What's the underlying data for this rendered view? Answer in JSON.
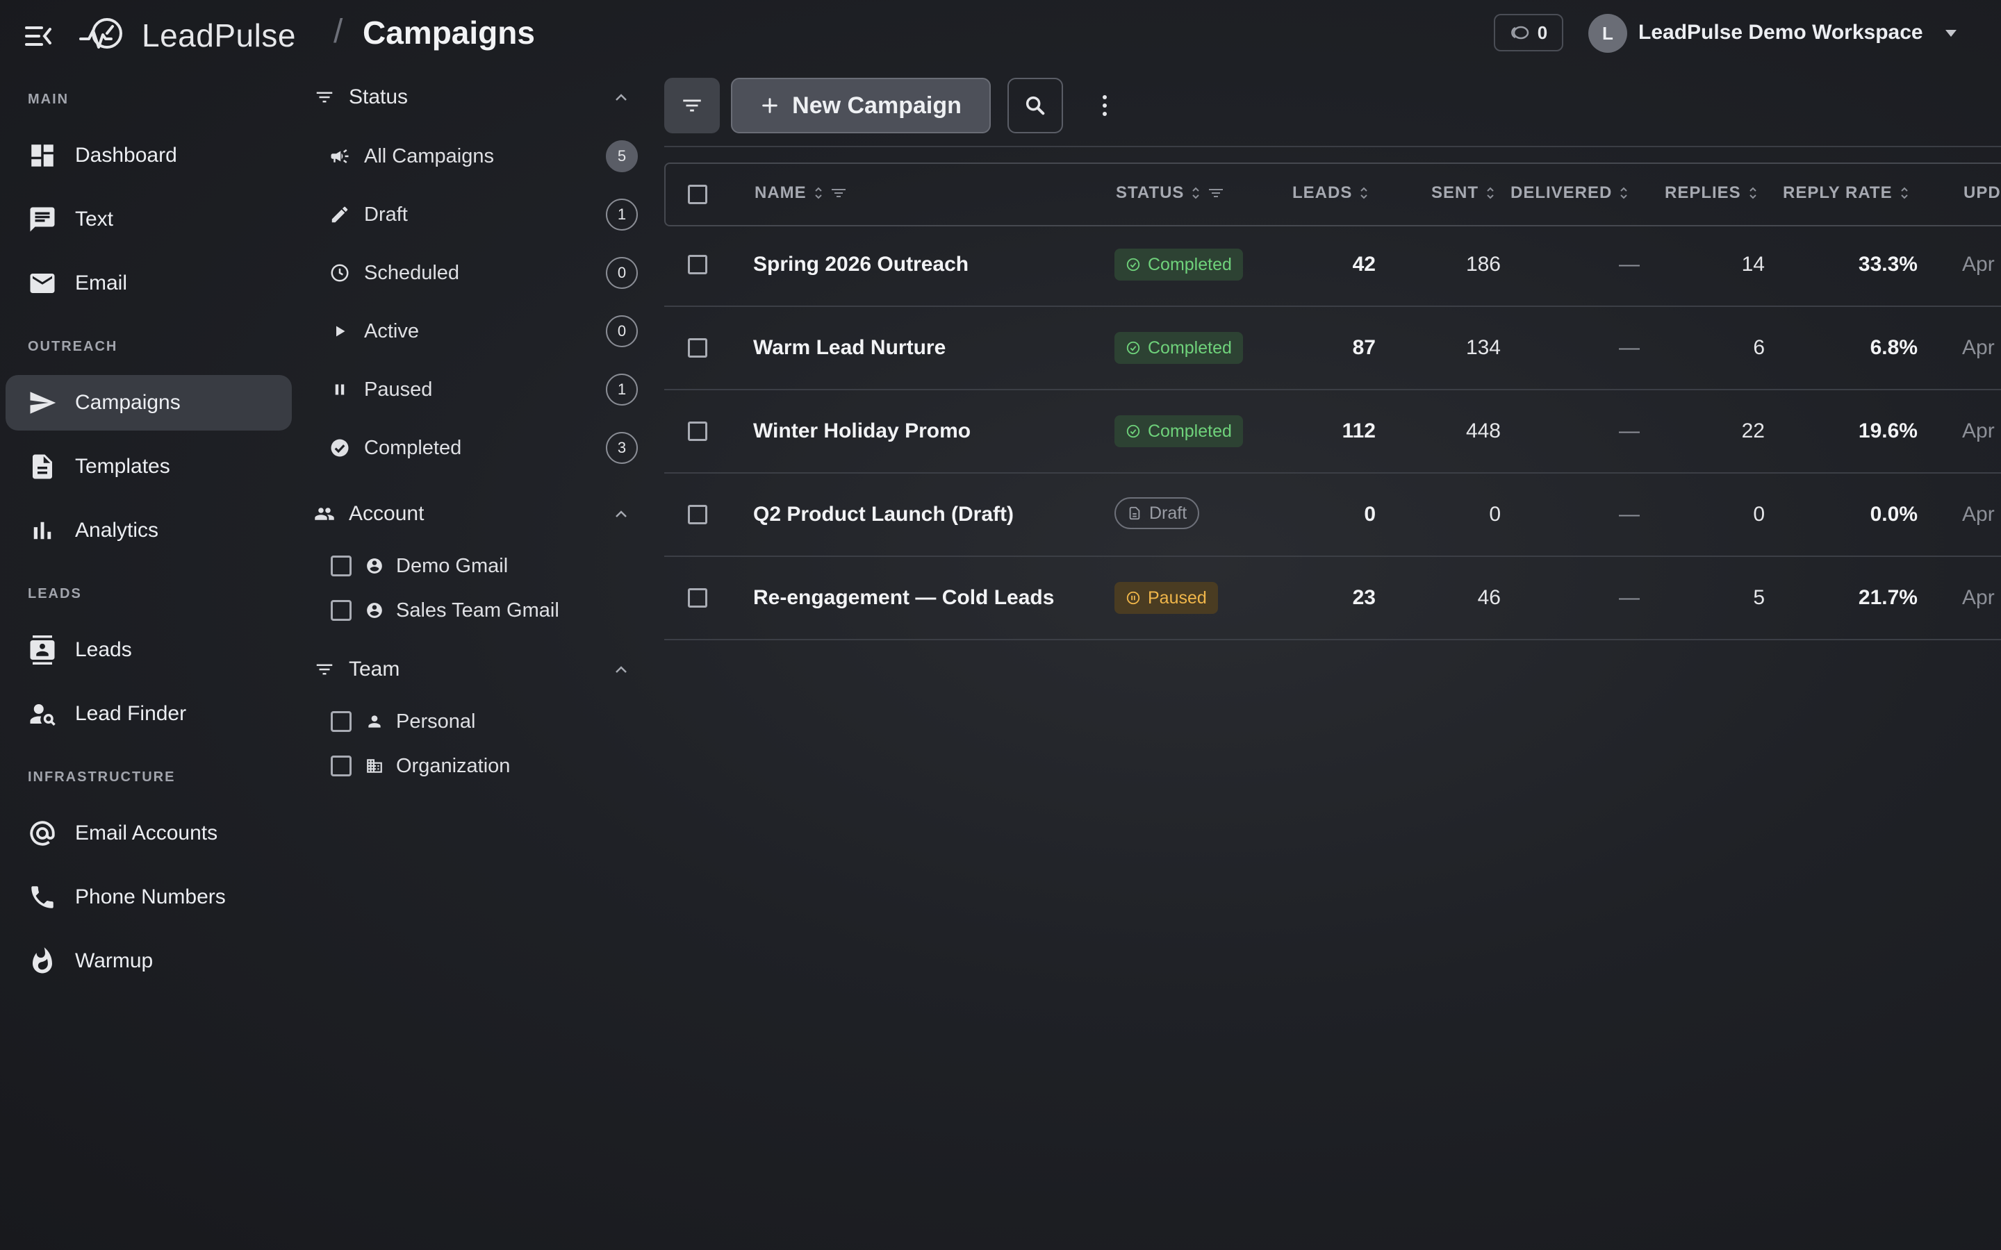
{
  "header": {
    "brand": "LeadPulse",
    "separator": "/",
    "page_title": "Campaigns",
    "credits": "0",
    "avatar_initial": "L",
    "workspace": "LeadPulse Demo Workspace"
  },
  "sidebar": {
    "sections": [
      {
        "label": "MAIN"
      },
      {
        "label": "OUTREACH"
      },
      {
        "label": "LEADS"
      },
      {
        "label": "INFRASTRUCTURE"
      }
    ],
    "items": [
      {
        "label": "Dashboard",
        "icon": "dashboard-icon"
      },
      {
        "label": "Text",
        "icon": "chat-icon"
      },
      {
        "label": "Email",
        "icon": "mail-icon"
      },
      {
        "label": "Campaigns",
        "icon": "send-icon",
        "active": true
      },
      {
        "label": "Templates",
        "icon": "document-icon"
      },
      {
        "label": "Analytics",
        "icon": "bar-chart-icon"
      },
      {
        "label": "Leads",
        "icon": "contact-card-icon"
      },
      {
        "label": "Lead Finder",
        "icon": "person-search-icon"
      },
      {
        "label": "Email Accounts",
        "icon": "at-sign-icon"
      },
      {
        "label": "Phone Numbers",
        "icon": "phone-icon"
      },
      {
        "label": "Warmup",
        "icon": "flame-icon"
      }
    ]
  },
  "filters": {
    "status": {
      "title": "Status",
      "items": [
        {
          "label": "All Campaigns",
          "count": "5"
        },
        {
          "label": "Draft",
          "count": "1"
        },
        {
          "label": "Scheduled",
          "count": "0"
        },
        {
          "label": "Active",
          "count": "0"
        },
        {
          "label": "Paused",
          "count": "1"
        },
        {
          "label": "Completed",
          "count": "3"
        }
      ]
    },
    "account": {
      "title": "Account",
      "items": [
        {
          "label": "Demo Gmail"
        },
        {
          "label": "Sales Team Gmail"
        }
      ]
    },
    "team": {
      "title": "Team",
      "items": [
        {
          "label": "Personal"
        },
        {
          "label": "Organization"
        }
      ]
    }
  },
  "toolbar": {
    "new_campaign_label": "New Campaign"
  },
  "table": {
    "columns": [
      "NAME",
      "STATUS",
      "LEADS",
      "SENT",
      "DELIVERED",
      "REPLIES",
      "REPLY RATE",
      "UPD"
    ],
    "rows": [
      {
        "name": "Spring 2026 Outreach",
        "status": "Completed",
        "leads": "42",
        "sent": "186",
        "delivered": "—",
        "replies": "14",
        "reply_rate": "33.3%",
        "updated": "Apr"
      },
      {
        "name": "Warm Lead Nurture",
        "status": "Completed",
        "leads": "87",
        "sent": "134",
        "delivered": "—",
        "replies": "6",
        "reply_rate": "6.8%",
        "updated": "Apr"
      },
      {
        "name": "Winter Holiday Promo",
        "status": "Completed",
        "leads": "112",
        "sent": "448",
        "delivered": "—",
        "replies": "22",
        "reply_rate": "19.6%",
        "updated": "Apr"
      },
      {
        "name": "Q2 Product Launch (Draft)",
        "status": "Draft",
        "leads": "0",
        "sent": "0",
        "delivered": "—",
        "replies": "0",
        "reply_rate": "0.0%",
        "updated": "Apr"
      },
      {
        "name": "Re-engagement — Cold Leads",
        "status": "Paused",
        "leads": "23",
        "sent": "46",
        "delivered": "—",
        "replies": "5",
        "reply_rate": "21.7%",
        "updated": "Apr"
      }
    ]
  },
  "colors": {
    "completed": "#6fd27b",
    "paused": "#f0b64a",
    "active_nav": "#393c43"
  }
}
